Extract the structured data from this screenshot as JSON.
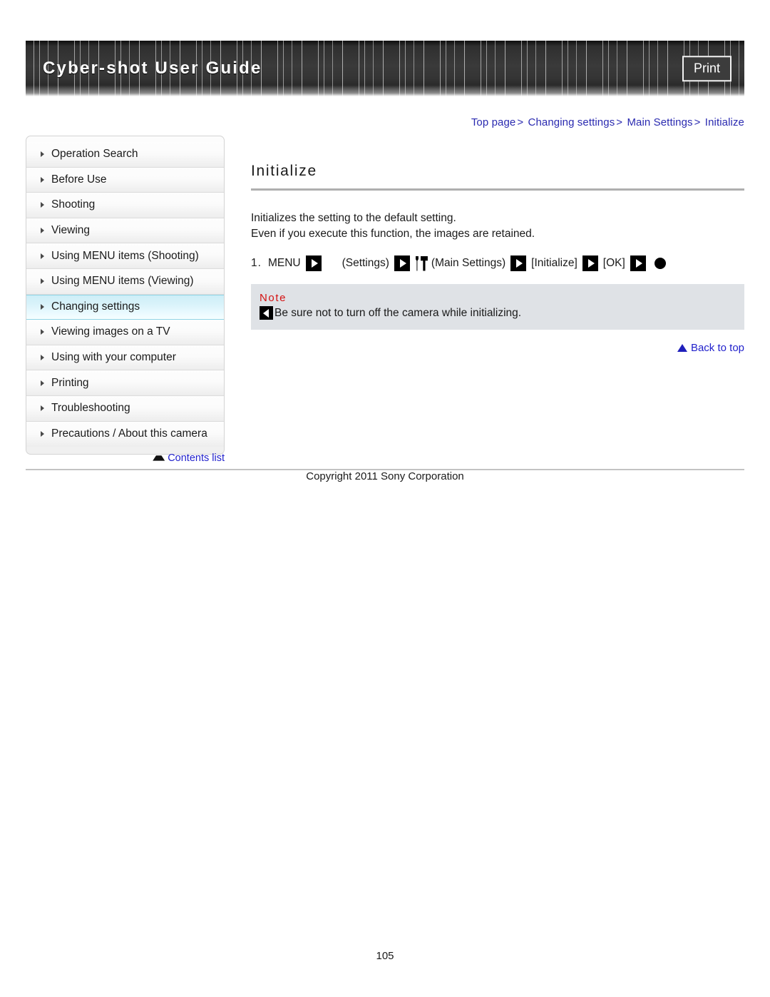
{
  "header": {
    "title": "Cyber-shot User Guide",
    "print_label": "Print"
  },
  "breadcrumb": {
    "items": [
      "Top page",
      "Changing settings",
      "Main Settings",
      "Initialize"
    ],
    "separator": ">"
  },
  "sidebar": {
    "items": [
      {
        "label": "Operation Search",
        "active": false
      },
      {
        "label": "Before Use",
        "active": false
      },
      {
        "label": "Shooting",
        "active": false
      },
      {
        "label": "Viewing",
        "active": false
      },
      {
        "label": "Using MENU items (Shooting)",
        "active": false
      },
      {
        "label": "Using MENU items (Viewing)",
        "active": false
      },
      {
        "label": "Changing settings",
        "active": true
      },
      {
        "label": "Viewing images on a TV",
        "active": false
      },
      {
        "label": "Using with your computer",
        "active": false
      },
      {
        "label": "Printing",
        "active": false
      },
      {
        "label": "Troubleshooting",
        "active": false
      },
      {
        "label": "Precautions / About this camera",
        "active": false
      }
    ],
    "contents_link": "Contents list",
    "contents_icon": "book-icon"
  },
  "main": {
    "title": "Initialize",
    "paragraph_line1": "Initializes the setting to the default setting.",
    "paragraph_line2": "Even if you execute this function, the images are retained.",
    "step": {
      "number": "1.",
      "t1": "MENU",
      "t2": "(Settings)",
      "t3": "(Main Settings)",
      "t4": "[Initialize]",
      "t5": "[OK]"
    },
    "note": {
      "heading": "Note",
      "text": "Be sure not to turn off the camera while initializing."
    },
    "back_to_top": "Back to top"
  },
  "footer": {
    "copyright": "Copyright 2011 Sony Corporation",
    "page_number": "105"
  },
  "colors": {
    "link": "#2222cc",
    "breadcrumb": "#2a2ab0",
    "note_heading": "#d41111",
    "note_bg": "#dfe2e6",
    "active_nav": "#cdeef7"
  }
}
